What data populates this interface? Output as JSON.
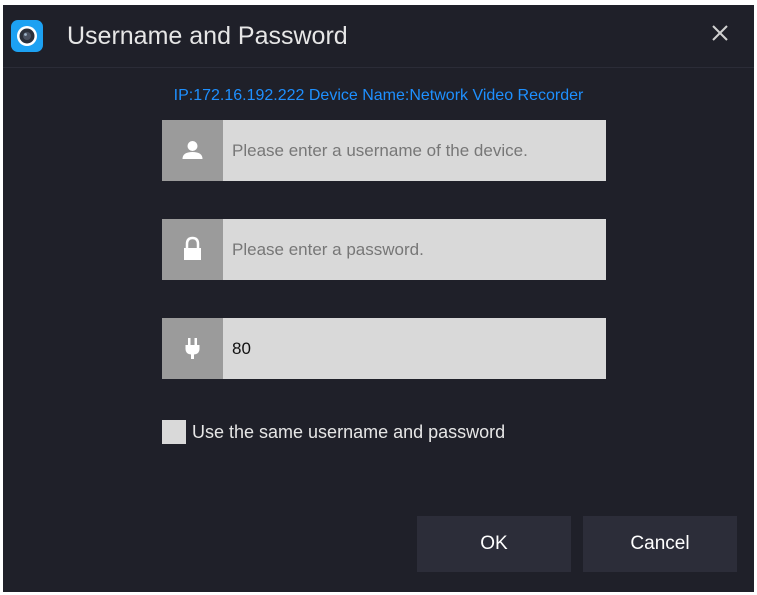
{
  "dialog": {
    "title": "Username and Password",
    "app_icon": "camera-icon",
    "close_icon": "close-icon"
  },
  "device_info": "IP:172.16.192.222 Device Name:Network Video Recorder",
  "fields": {
    "username": {
      "icon": "user-icon",
      "value": "",
      "placeholder": "Please enter a username of the device."
    },
    "password": {
      "icon": "lock-icon",
      "value": "",
      "placeholder": "Please enter a password."
    },
    "port": {
      "icon": "plug-icon",
      "value": "80",
      "placeholder": ""
    }
  },
  "same_credentials": {
    "label": "Use the same username and password",
    "checked": false
  },
  "buttons": {
    "ok": "OK",
    "cancel": "Cancel"
  },
  "colors": {
    "background": "#1f2029",
    "accent": "#1e90ff",
    "field_bg": "#d9d9d9",
    "icon_bg": "#9b9b9b",
    "button_bg": "#2c2d39"
  }
}
